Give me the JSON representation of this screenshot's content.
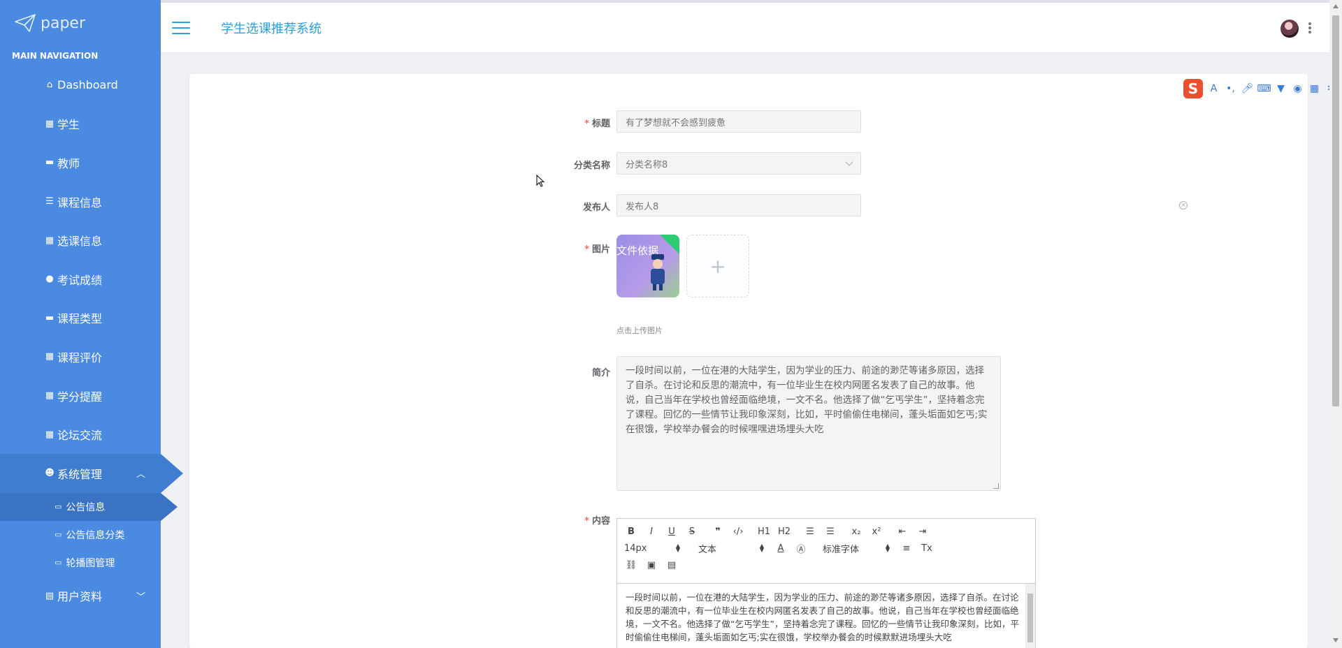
{
  "sidebar": {
    "logo_text": "paper",
    "section_label": "MAIN NAVIGATION",
    "items": [
      {
        "label": "Dashboard",
        "icon": "home-icon"
      },
      {
        "label": "学生",
        "icon": "grid-icon"
      },
      {
        "label": "教师",
        "icon": "briefcase-icon"
      },
      {
        "label": "课程信息",
        "icon": "sliders-icon"
      },
      {
        "label": "选课信息",
        "icon": "grid-icon"
      },
      {
        "label": "考试成绩",
        "icon": "pin-icon"
      },
      {
        "label": "课程类型",
        "icon": "monitor-icon"
      },
      {
        "label": "课程评价",
        "icon": "grid-icon"
      },
      {
        "label": "学分提醒",
        "icon": "grid-icon"
      },
      {
        "label": "论坛交流",
        "icon": "grid-icon"
      },
      {
        "label": "系统管理",
        "icon": "user-icon"
      }
    ],
    "sub_items": [
      {
        "label": "公告信息",
        "icon": "folder-icon"
      },
      {
        "label": "公告信息分类",
        "icon": "folder-icon"
      },
      {
        "label": "轮播图管理",
        "icon": "folder-icon"
      }
    ],
    "last_item": {
      "label": "用户资料",
      "icon": "calendar-icon"
    }
  },
  "header": {
    "title": "学生选课推荐系统"
  },
  "form": {
    "title_label": "标题",
    "title_value": "有了梦想就不会感到疲惫",
    "category_label": "分类名称",
    "category_value": "分类名称8",
    "publisher_label": "发布人",
    "publisher_value": "发布人8",
    "image_label": "图片",
    "image_overlay_text": "文件依据",
    "upload_tip": "点击上传图片",
    "intro_label": "简介",
    "intro_value": "一段时间以前，一位在港的大陆学生，因为学业的压力、前途的渺茫等诸多原因，选择了自杀。在讨论和反思的潮流中，有一位毕业生在校内网匿名发表了自己的故事。他说，自己当年在学校也曾经面临绝境，一文不名。他选择了做“乞丐学生”，坚持着念完了课程。回忆的一些情节让我印象深刻，比如，平时偷偷住电梯间，蓬头垢面如乞丐;实在很饿，学校举办餐会的时候嘿嘿进场埋头大吃",
    "content_label": "内容",
    "content_value": "一段时间以前，一位在港的大陆学生，因为学业的压力、前途的渺茫等诸多原因，选择了自杀。在讨论和反思的潮流中，有一位毕业生在校内网匿名发表了自己的故事。他说，自己当年在学校也曾经面临绝境，一文不名。他选择了做“乞丐学生”，坚持着念完了课程。回忆的一些情节让我印象深刻，比如，平时偷偷住电梯间，蓬头垢面如乞丐;实在很饿，学校举办餐会的时候默默进场埋头大吃"
  },
  "editor": {
    "font_size": "14px",
    "paragraph": "文本",
    "font_family": "标准字体",
    "h1": "H1",
    "h2": "H2"
  },
  "colors": {
    "sidebar": "#4a8ae0",
    "accent": "#2b9fd8",
    "required": "#f56c6c"
  }
}
